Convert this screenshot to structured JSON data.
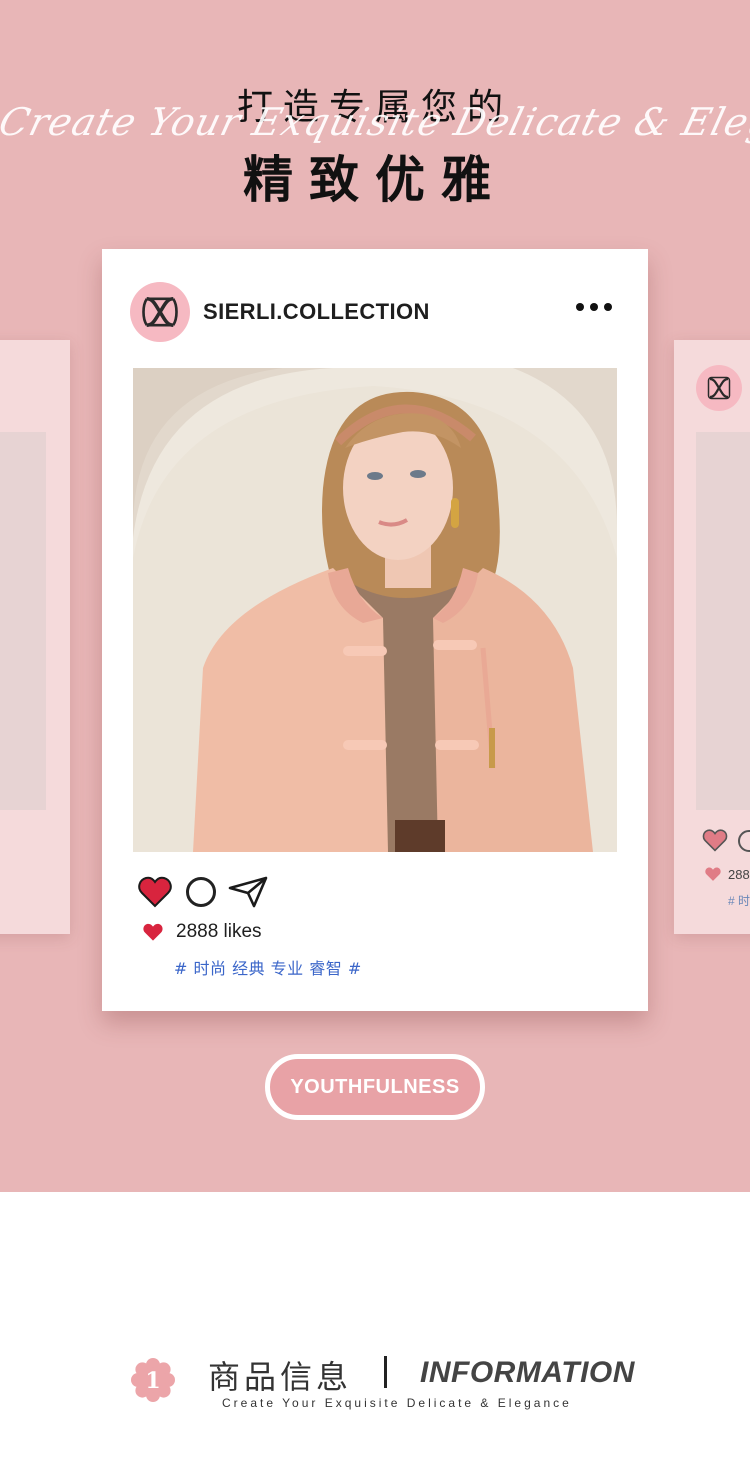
{
  "headline": {
    "line1": "打造专属您的",
    "script": "Create Your Exquisite Delicate & Elegance",
    "line2": "精致优雅"
  },
  "post": {
    "username": "SIERLI.COLLECTION",
    "more_icon": "more-horizontal-icon",
    "likes_text": "2888 likes",
    "tags": "# 时尚 经典 专业 睿智 #"
  },
  "side_right": {
    "likes_text": "288",
    "tags": "# 时"
  },
  "badge": {
    "label": "YOUTHFULNESS"
  },
  "info": {
    "number": "1",
    "title_cn": "商品信息",
    "title_en": "INFORMATION",
    "subtitle": "Create Your Exquisite Delicate & Elegance"
  },
  "colors": {
    "background_pink": "#e8b6b7",
    "side_card": "#f5dadb",
    "avatar_pink": "#f6b9c2",
    "heart_red": "#d8243e",
    "tag_blue": "#3b66c9",
    "pill_pink": "#e8a2a6"
  }
}
